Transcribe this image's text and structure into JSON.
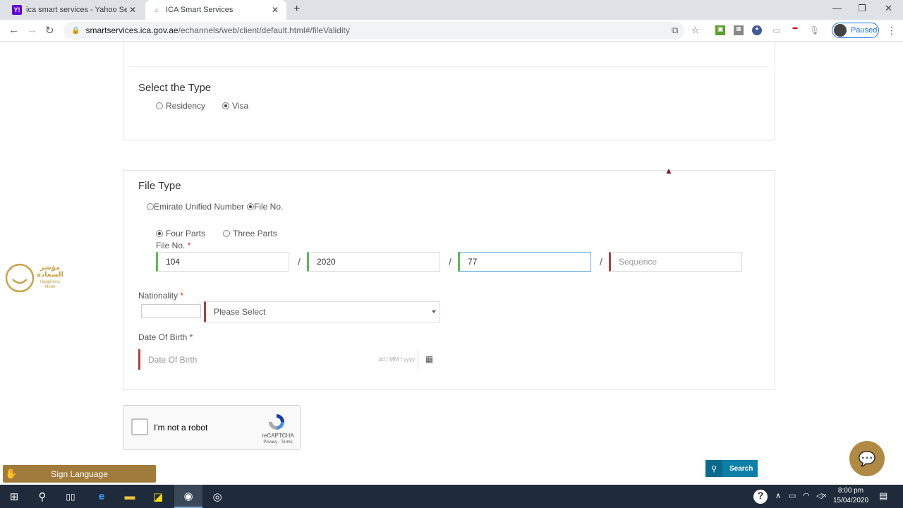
{
  "browser": {
    "tabs": [
      {
        "title": "ica smart services - Yahoo Search",
        "favicon": "Y!"
      },
      {
        "title": "ICA Smart Services"
      }
    ],
    "url_host": "smartservices.ica.gov.ae",
    "url_path": "/echannels/web/client/default.html#/fileValidity",
    "profile_status": "Paused"
  },
  "type_section": {
    "title": "Select the Type",
    "options": [
      "Residency",
      "Visa"
    ],
    "selected": "Visa"
  },
  "file_type_section": {
    "title": "File Type",
    "options": [
      "Emirate Unified Number",
      "File No."
    ],
    "selected": "File No.",
    "parts_options": [
      "Four Parts",
      "Three Parts"
    ],
    "parts_selected": "Four Parts",
    "file_no_label": "File No.",
    "required_mark": "*",
    "file_no_values": [
      "104",
      "2020",
      "77"
    ],
    "sequence_placeholder": "Sequence",
    "separator": "/",
    "nationality_label": "Nationality",
    "nationality_placeholder": "Please Select",
    "dob_label": "Date Of Birth",
    "dob_placeholder": "Date Of Birth",
    "dob_format": "dd / MM / yyyy"
  },
  "captcha": {
    "label": "I'm not a robot",
    "brand": "reCAPTCHA",
    "terms": "Privacy - Terms"
  },
  "search_button": "Search",
  "sign_language": "Sign Language",
  "happiness_meter": {
    "arabic": "مؤشر السعادة",
    "english": "Happiness Meter"
  },
  "taskbar": {
    "time": "8:00 pm",
    "date": "15/04/2020"
  },
  "colors": {
    "valid": "#5cb85c",
    "invalid": "#a94442",
    "primary": "#0e7fa6",
    "gold": "#a07b3b"
  }
}
